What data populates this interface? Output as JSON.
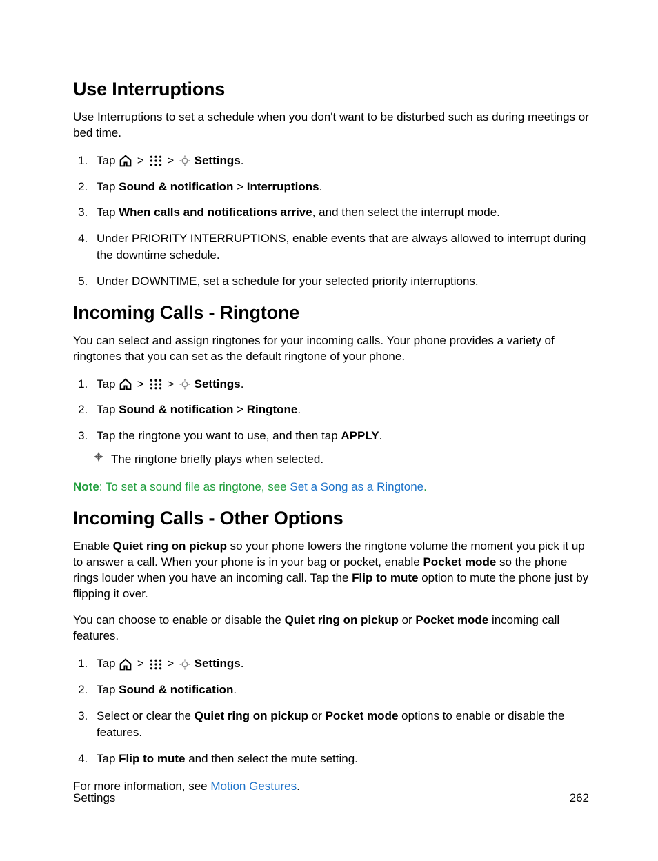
{
  "sections": [
    {
      "heading": "Use Interruptions",
      "intro": "Use Interruptions to set a schedule when you don't want to be disturbed such as during meetings or bed time.",
      "steps": [
        {
          "prefix": "Tap ",
          "hasIcons": true,
          "settings": "Settings",
          "suffix": "."
        },
        {
          "html1_pre": "Tap ",
          "b1": "Sound & notification",
          "mid": " > ",
          "b2": "Interruptions",
          "post": "."
        },
        {
          "html2_pre": "Tap ",
          "b1": "When calls and notifications arrive",
          "post": ", and then select the interrupt mode."
        },
        {
          "plain": "Under PRIORITY INTERRUPTIONS, enable events that are always allowed to interrupt during the downtime schedule."
        },
        {
          "plain": "Under DOWNTIME, set a schedule for your selected priority interruptions."
        }
      ]
    },
    {
      "heading": "Incoming Calls - Ringtone",
      "intro": "You can select and assign ringtones for your incoming calls. Your phone provides a variety of ringtones that you can set as the default ringtone of your phone.",
      "steps": [
        {
          "prefix": "Tap ",
          "hasIcons": true,
          "settings": "Settings",
          "suffix": "."
        },
        {
          "html1_pre": "Tap ",
          "b1": "Sound & notification",
          "mid": " > ",
          "b2": "Ringtone",
          "post": "."
        },
        {
          "r3_pre": "Tap the ringtone you want to use, and then tap ",
          "r3_b": "APPLY",
          "r3_post": ".",
          "sub": "The ringtone briefly plays when selected."
        }
      ],
      "note": {
        "label": "Note",
        "text": ": To set a sound file as ringtone, see ",
        "link": "Set a Song as a Ringtone",
        "after": "."
      }
    },
    {
      "heading": "Incoming Calls - Other Options",
      "intro_parts": {
        "p1a": "Enable ",
        "p1b": "Quiet ring on pickup",
        "p1c": " so your phone lowers the ringtone volume the moment you pick it up to answer a call. When your phone is in your bag or pocket, enable ",
        "p1d": "Pocket mode",
        "p1e": " so the phone rings louder when you have an incoming call. Tap the ",
        "p1f": "Flip to mute",
        "p1g": " option to mute the phone just by flipping it over."
      },
      "intro2_parts": {
        "p2a": "You can choose to enable or disable the ",
        "p2b": "Quiet ring on pickup",
        "p2c": " or ",
        "p2d": "Pocket mode",
        "p2e": " incoming call features."
      },
      "steps": [
        {
          "prefix": "Tap ",
          "hasIcons": true,
          "settings": "Settings",
          "suffix": "."
        },
        {
          "html1_pre": "Tap ",
          "b1": "Sound & notification",
          "post": "."
        },
        {
          "s3_pre": "Select or clear the ",
          "s3_b1": "Quiet ring on pickup",
          "s3_mid": " or ",
          "s3_b2": "Pocket mode",
          "s3_post": " options to enable or disable the features."
        },
        {
          "s4_pre": "Tap ",
          "s4_b": "Flip to mute",
          "s4_post": " and then select the mute setting."
        }
      ],
      "outro": {
        "pre": "For more information, see ",
        "link": "Motion Gestures",
        "post": "."
      }
    }
  ],
  "footer": {
    "left": "Settings",
    "right": "262"
  }
}
